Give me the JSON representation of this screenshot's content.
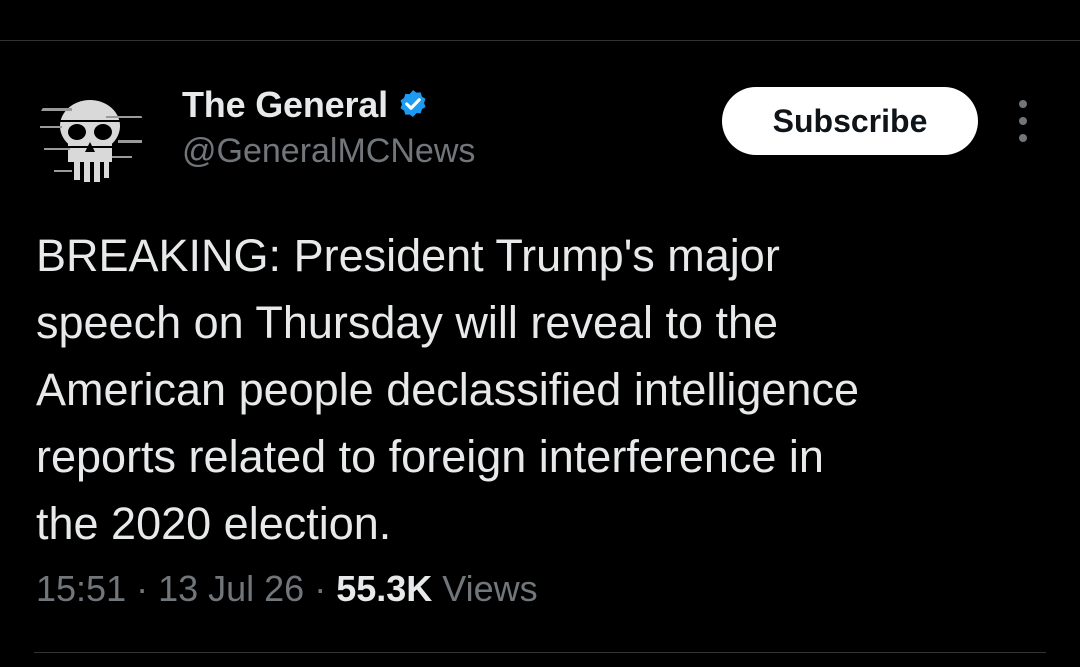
{
  "author": {
    "display_name": "The General",
    "handle": "@GeneralMCNews",
    "verified": true,
    "verified_color": "#1d9bf0",
    "avatar_icon": "skull-avatar-icon"
  },
  "actions": {
    "subscribe_label": "Subscribe",
    "more_icon": "more-options-icon"
  },
  "tweet": {
    "lines": [
      "BREAKING: President Trump's major",
      "speech on Thursday will reveal to the",
      "American people declassified intelligence",
      "reports related to foreign interference in",
      "the 2020 election."
    ]
  },
  "meta": {
    "time": "15:51",
    "separator": " · ",
    "date": "13 Jul 26",
    "views_count": "55.3K",
    "views_label": " Views"
  },
  "colors": {
    "background": "#000000",
    "primary_text": "#e7e9ea",
    "secondary_text": "#71767b",
    "divider": "#2f3336",
    "button_bg": "#ffffff",
    "button_text": "#0f1419"
  }
}
